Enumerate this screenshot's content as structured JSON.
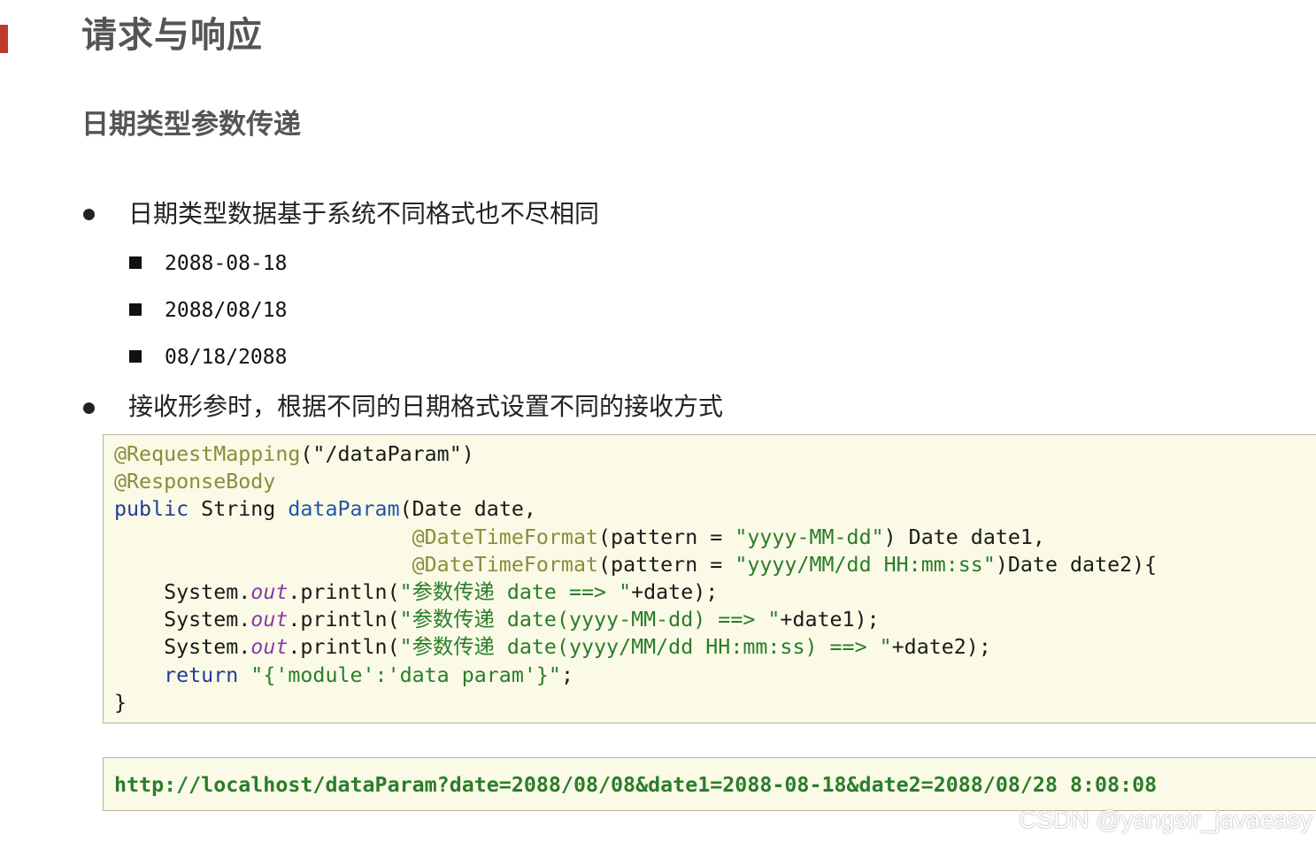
{
  "page": {
    "title": "请求与响应",
    "subtitle": "日期类型参数传递",
    "accent_color": "#c0392b"
  },
  "bullets": [
    {
      "text": "日期类型数据基于系统不同格式也不尽相同",
      "sub_items": [
        "2088-08-18",
        "2088/08/18",
        "08/18/2088"
      ]
    },
    {
      "text": "接收形参时，根据不同的日期格式设置不同的接收方式"
    }
  ],
  "code": {
    "line1": {
      "ann": "@RequestMapping",
      "rest": "(\"/dataParam\")"
    },
    "line2": {
      "ann": "@ResponseBody"
    },
    "line3": {
      "kw": "public",
      "type": " String ",
      "method": "dataParam",
      "rest": "(Date date,"
    },
    "line4": {
      "indent": "                        ",
      "ann": "@DateTimeFormat",
      "pre": "(pattern = ",
      "str": "\"yyyy-MM-dd\"",
      "rest": ") Date date1,"
    },
    "line5": {
      "indent": "                        ",
      "ann": "@DateTimeFormat",
      "pre": "(pattern = ",
      "str": "\"yyyy/MM/dd HH:mm:ss\"",
      "rest": ")Date date2){"
    },
    "line6": {
      "pre": "    System.",
      "field": "out",
      "mid": ".println(",
      "str": "\"参数传递 date ==> \"",
      "rest": "+date);"
    },
    "line7": {
      "pre": "    System.",
      "field": "out",
      "mid": ".println(",
      "str": "\"参数传递 date(yyyy-MM-dd) ==> \"",
      "rest": "+date1);"
    },
    "line8": {
      "pre": "    System.",
      "field": "out",
      "mid": ".println(",
      "str": "\"参数传递 date(yyyy/MM/dd HH:mm:ss) ==> \"",
      "rest": "+date2);"
    },
    "line9": {
      "indent": "    ",
      "kw": "return",
      "str": " \"{'module':'data param'}\"",
      "rest": ";"
    },
    "line10": {
      "text": "}"
    }
  },
  "url": "http://localhost/dataParam?date=2088/08/08&date1=2088-08-18&date2=2088/08/28 8:08:08",
  "watermark": "CSDN @yangsir_javaeasy"
}
